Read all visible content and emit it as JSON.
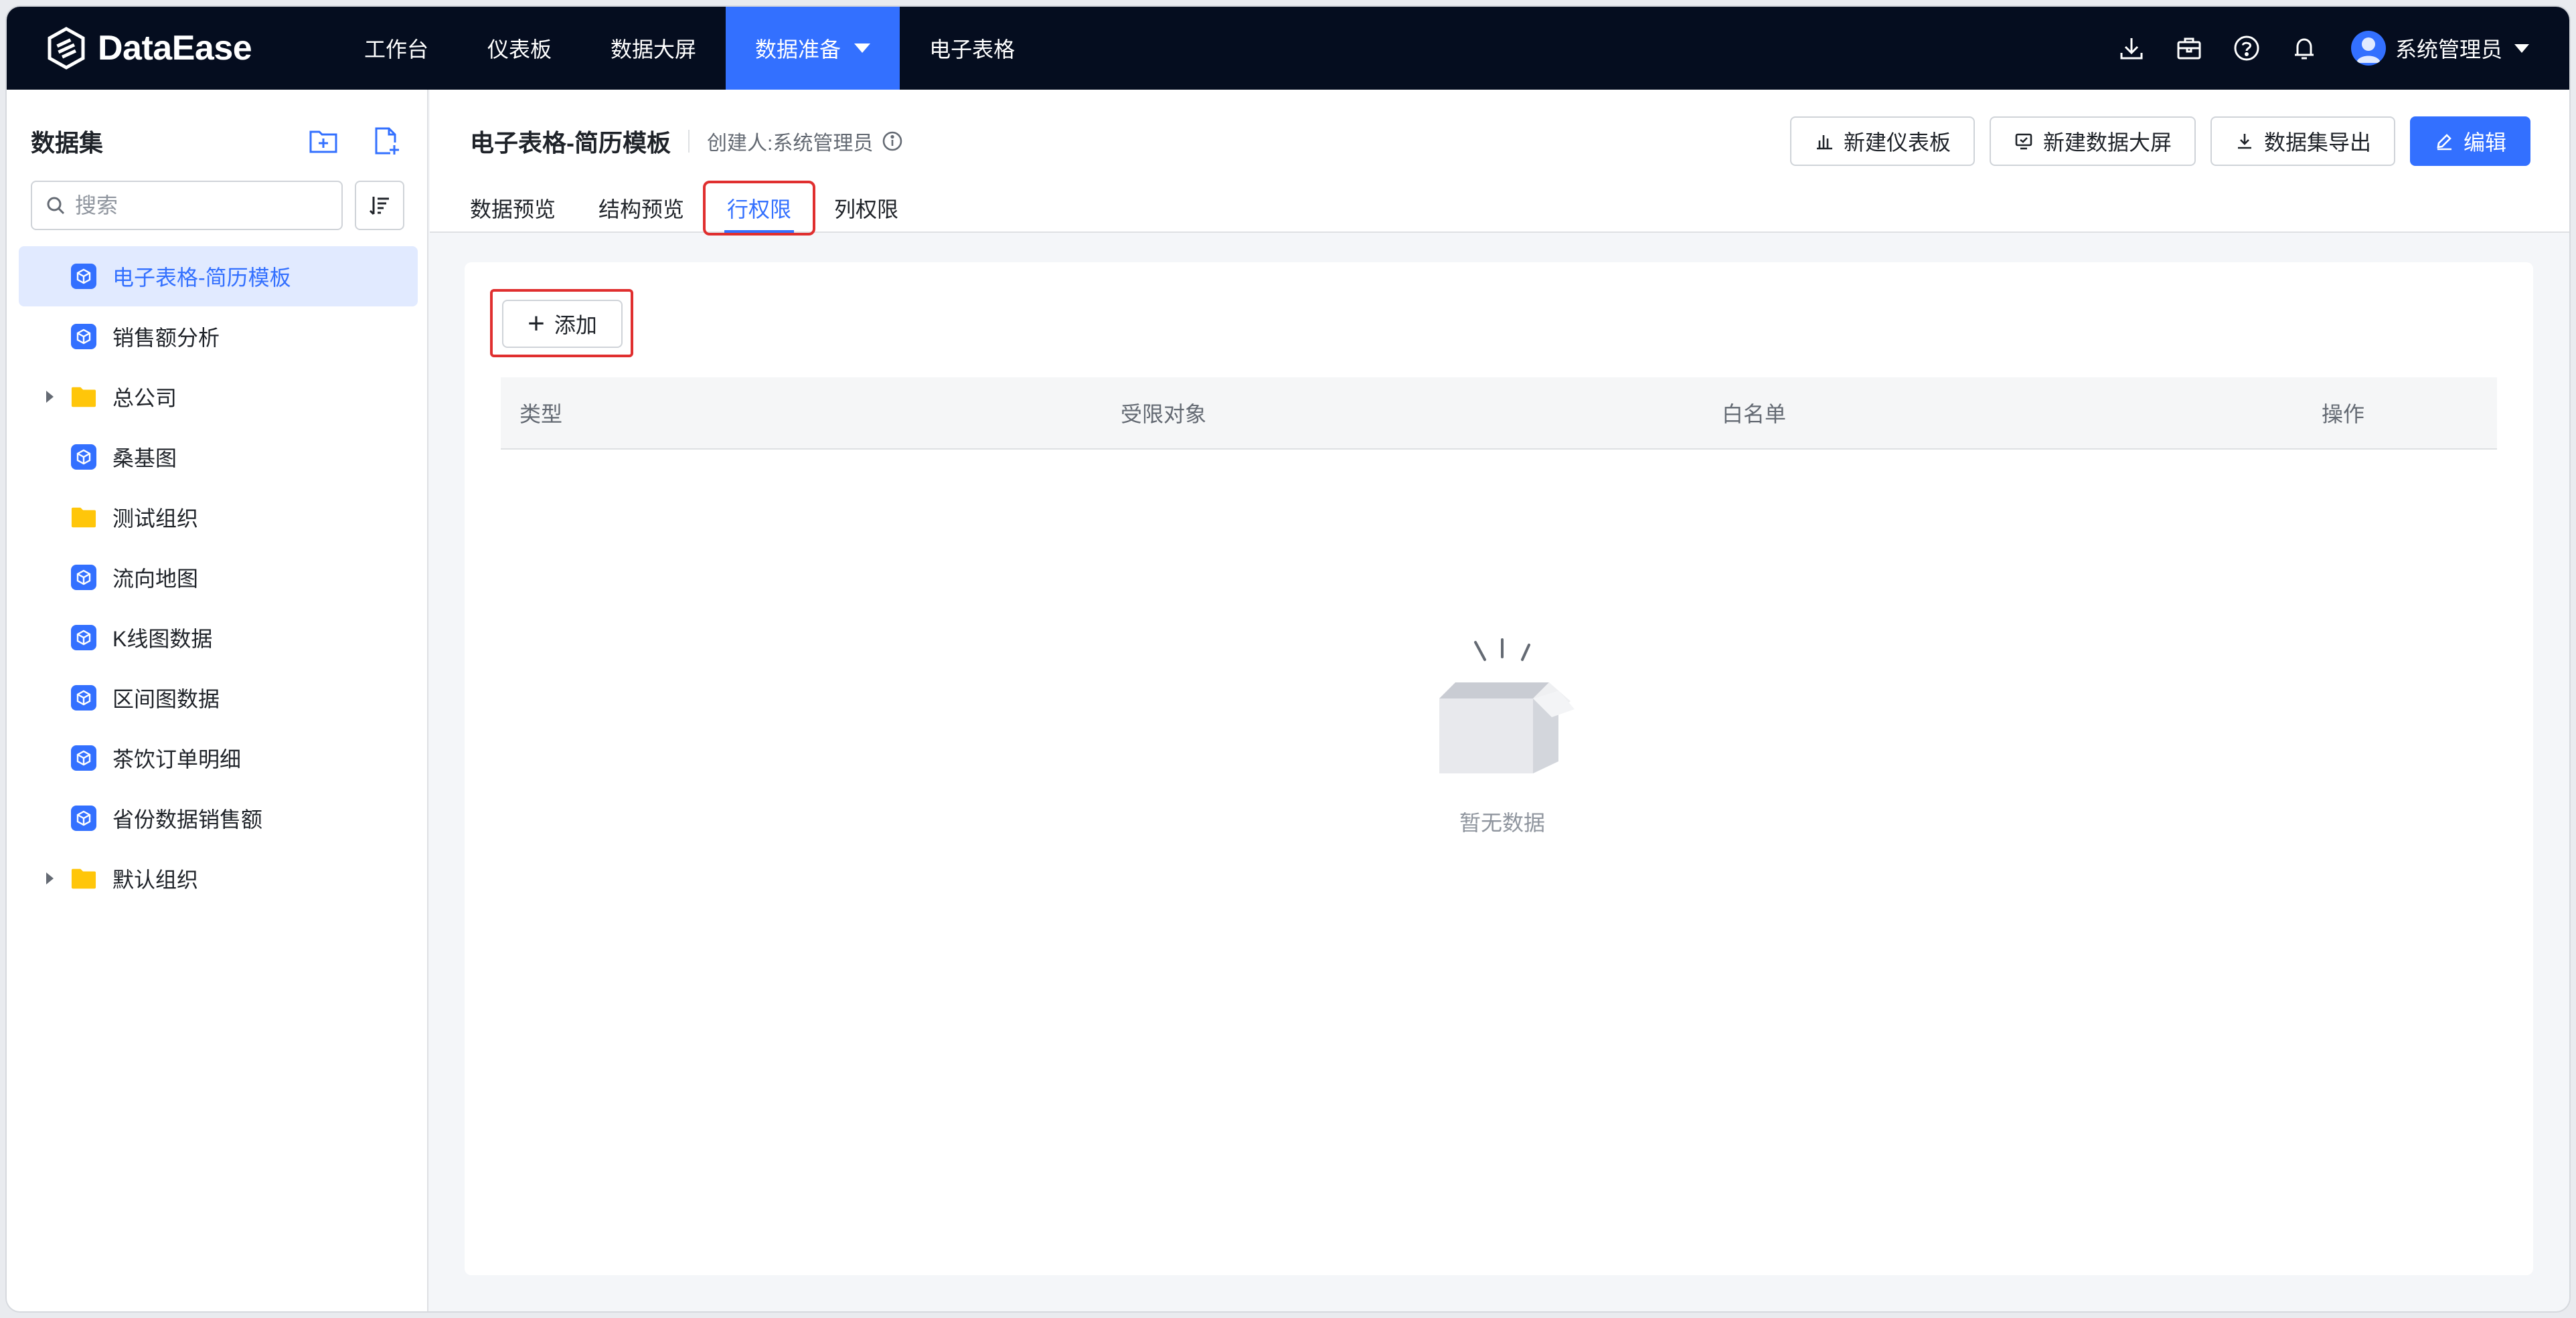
{
  "app": {
    "logo_text": "DataEase"
  },
  "nav": {
    "items": [
      {
        "label": "工作台"
      },
      {
        "label": "仪表板"
      },
      {
        "label": "数据大屏"
      },
      {
        "label": "数据准备"
      },
      {
        "label": "电子表格"
      }
    ],
    "active_index": 3
  },
  "user": {
    "name": "系统管理员"
  },
  "sidebar": {
    "title": "数据集",
    "search_placeholder": "搜索",
    "items": [
      {
        "label": "电子表格-简历模板",
        "type": "dataset",
        "selected": true
      },
      {
        "label": "销售额分析",
        "type": "dataset"
      },
      {
        "label": "总公司",
        "type": "folder",
        "expandable": true
      },
      {
        "label": "桑基图",
        "type": "dataset"
      },
      {
        "label": "测试组织",
        "type": "folder"
      },
      {
        "label": "流向地图",
        "type": "dataset"
      },
      {
        "label": "K线图数据",
        "type": "dataset"
      },
      {
        "label": "区间图数据",
        "type": "dataset"
      },
      {
        "label": "茶饮订单明细",
        "type": "dataset"
      },
      {
        "label": "省份数据销售额",
        "type": "dataset"
      },
      {
        "label": "默认组织",
        "type": "folder",
        "expandable": true
      }
    ]
  },
  "header": {
    "title": "电子表格-简历模板",
    "creator": "创建人:系统管理员",
    "actions": {
      "new_dashboard": "新建仪表板",
      "new_screen": "新建数据大屏",
      "export": "数据集导出",
      "edit": "编辑"
    },
    "tabs": [
      {
        "label": "数据预览"
      },
      {
        "label": "结构预览"
      },
      {
        "label": "行权限"
      },
      {
        "label": "列权限"
      }
    ],
    "active_tab": 2
  },
  "content": {
    "add_label": "添加",
    "columns": [
      "类型",
      "受限对象",
      "白名单",
      "操作"
    ],
    "empty_text": "暂无数据"
  },
  "colors": {
    "accent": "#3370ff",
    "nav_bg": "#050d1f",
    "highlight": "#e02f2f",
    "folder": "#ffc60a"
  }
}
